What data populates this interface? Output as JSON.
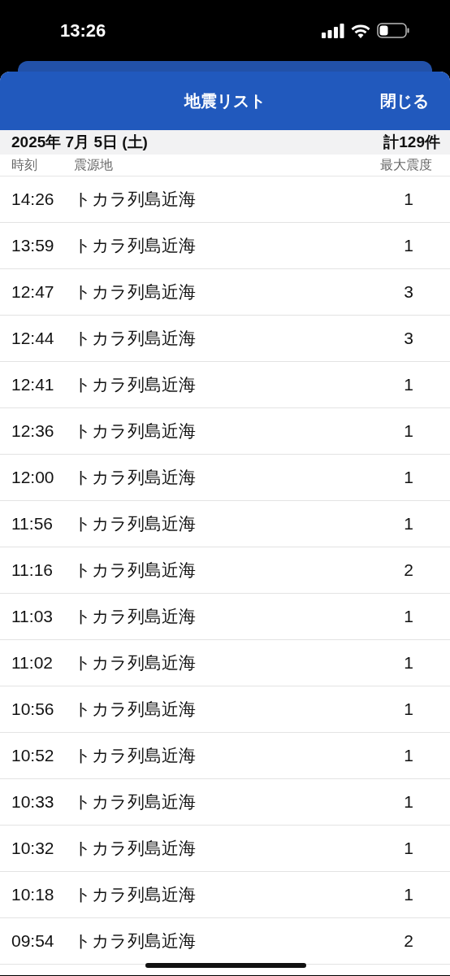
{
  "status_bar": {
    "time": "13:26"
  },
  "header": {
    "title": "地震リスト",
    "close": "閉じる"
  },
  "date_bar": {
    "date": "2025年 7月 5日 (土)",
    "total": "計129件"
  },
  "columns": [
    "時刻",
    "震源地",
    "最大震度"
  ],
  "rows": [
    {
      "time": "14:26",
      "place": "トカラ列島近海",
      "intensity": "1"
    },
    {
      "time": "13:59",
      "place": "トカラ列島近海",
      "intensity": "1"
    },
    {
      "time": "12:47",
      "place": "トカラ列島近海",
      "intensity": "3"
    },
    {
      "time": "12:44",
      "place": "トカラ列島近海",
      "intensity": "3"
    },
    {
      "time": "12:41",
      "place": "トカラ列島近海",
      "intensity": "1"
    },
    {
      "time": "12:36",
      "place": "トカラ列島近海",
      "intensity": "1"
    },
    {
      "time": "12:00",
      "place": "トカラ列島近海",
      "intensity": "1"
    },
    {
      "time": "11:56",
      "place": "トカラ列島近海",
      "intensity": "1"
    },
    {
      "time": "11:16",
      "place": "トカラ列島近海",
      "intensity": "2"
    },
    {
      "time": "11:03",
      "place": "トカラ列島近海",
      "intensity": "1"
    },
    {
      "time": "11:02",
      "place": "トカラ列島近海",
      "intensity": "1"
    },
    {
      "time": "10:56",
      "place": "トカラ列島近海",
      "intensity": "1"
    },
    {
      "time": "10:52",
      "place": "トカラ列島近海",
      "intensity": "1"
    },
    {
      "time": "10:33",
      "place": "トカラ列島近海",
      "intensity": "1"
    },
    {
      "time": "10:32",
      "place": "トカラ列島近海",
      "intensity": "1"
    },
    {
      "time": "10:18",
      "place": "トカラ列島近海",
      "intensity": "1"
    },
    {
      "time": "09:54",
      "place": "トカラ列島近海",
      "intensity": "2"
    }
  ]
}
